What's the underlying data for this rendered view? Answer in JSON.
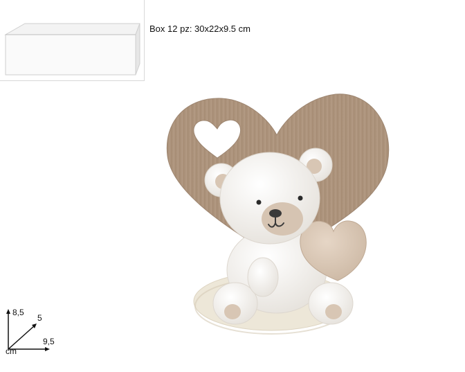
{
  "box_info": {
    "caption": "Box 12 pz: 30x22x9.5 cm"
  },
  "dimensions": {
    "height": "8,5",
    "depth": "5",
    "width": "9,5",
    "unit": "cm"
  },
  "colors": {
    "wood": "#b09780",
    "bear": "#f4f2ee",
    "beige": "#d9c7b5",
    "base": "#ece6d6"
  }
}
